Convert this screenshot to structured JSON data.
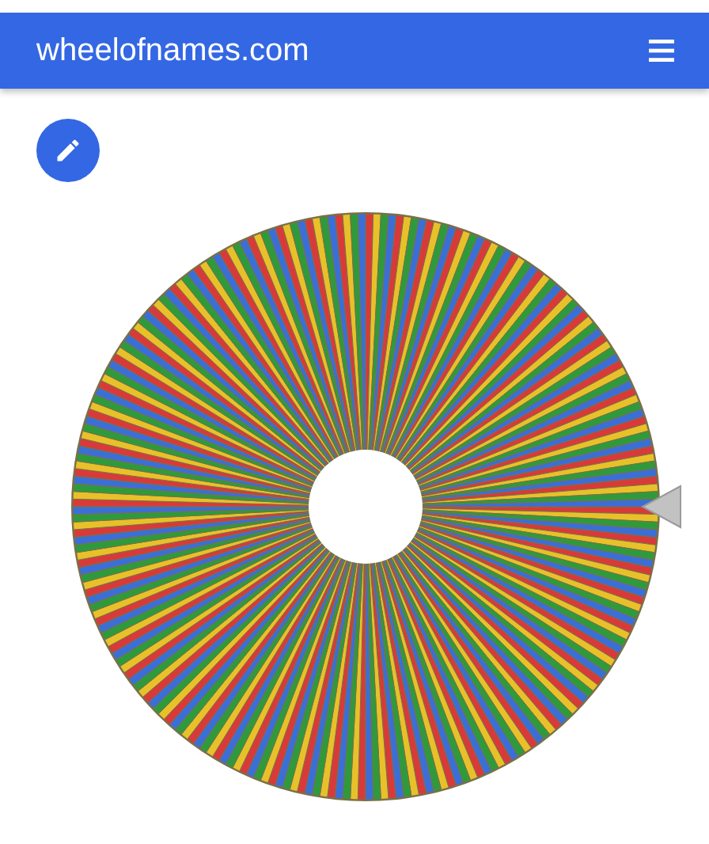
{
  "header": {
    "title": "wheelofnames.com"
  }
}
